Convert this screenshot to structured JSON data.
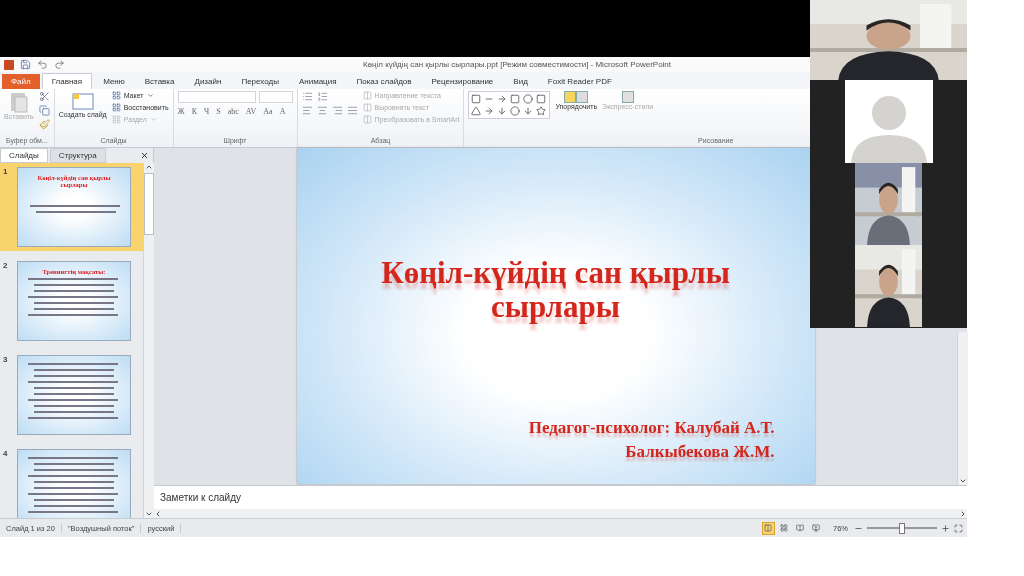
{
  "window": {
    "title": "Көңіл күйдің сан қырлы сырлары.ppt [Режим совместимости] - Microsoft PowerPoint"
  },
  "ribbon": {
    "tabs": [
      {
        "label": "Файл",
        "kind": "file",
        "selected": false
      },
      {
        "label": "Главная",
        "kind": "tab",
        "selected": true
      },
      {
        "label": "Меню",
        "kind": "tab",
        "selected": false
      },
      {
        "label": "Вставка",
        "kind": "tab",
        "selected": false
      },
      {
        "label": "Дизайн",
        "kind": "tab",
        "selected": false
      },
      {
        "label": "Переходы",
        "kind": "tab",
        "selected": false
      },
      {
        "label": "Анимация",
        "kind": "tab",
        "selected": false
      },
      {
        "label": "Показ слайдов",
        "kind": "tab",
        "selected": false
      },
      {
        "label": "Рецензирование",
        "kind": "tab",
        "selected": false
      },
      {
        "label": "Вид",
        "kind": "tab",
        "selected": false
      },
      {
        "label": "Foxit Reader PDF",
        "kind": "tab",
        "selected": false
      }
    ],
    "clipboard": {
      "label": "Буфер обм...",
      "paste": {
        "label": "Вставить",
        "disabled": true
      }
    },
    "slides": {
      "label": "Слайды",
      "new_slide": {
        "label": "Создать слайд",
        "disabled": false
      },
      "commands": [
        {
          "label": "Макет",
          "disabled": false,
          "dropdown": true
        },
        {
          "label": "Восстановить",
          "disabled": false,
          "dropdown": false
        },
        {
          "label": "Раздел",
          "disabled": true,
          "dropdown": true
        }
      ]
    },
    "font": {
      "label": "Шрифт",
      "buttons": [
        "Ж",
        "К",
        "Ч",
        "S",
        "abc",
        "AV",
        "Aa",
        "A"
      ]
    },
    "paragraph": {
      "label": "Абзац",
      "commands": [
        {
          "label": "Направление текста",
          "disabled": true
        },
        {
          "label": "Выровнять текст",
          "disabled": true
        },
        {
          "label": "Преобразовать в SmartArt",
          "disabled": true
        }
      ]
    },
    "drawing": {
      "label": "Рисование",
      "arrange": {
        "label": "Упорядочить",
        "disabled": false
      },
      "quick_styles": {
        "label": "Экспресс-стили",
        "disabled": true
      }
    }
  },
  "slides_pane": {
    "tabs": [
      {
        "label": "Слайды",
        "selected": true
      },
      {
        "label": "Структура",
        "selected": false
      }
    ],
    "thumbnails": [
      {
        "number": "1",
        "selected": true,
        "kind": "title",
        "title": "Көңіл-күйдің сан қырлы сырлары"
      },
      {
        "number": "2",
        "selected": false,
        "kind": "list",
        "title": "Тренингтің мақсаты:"
      },
      {
        "number": "3",
        "selected": false,
        "kind": "bullets"
      },
      {
        "number": "4",
        "selected": false,
        "kind": "bullets"
      }
    ]
  },
  "slide": {
    "title": "Көңіл-күйдің сан қырлы сырлары",
    "authors": [
      "Педагог-психолог: Калубай А.Т.",
      "Балкыбекова Ж.М."
    ]
  },
  "notes": {
    "placeholder": "Заметки к слайду"
  },
  "status_bar": {
    "items": [
      "Слайд 1 из 20",
      "\"Воздушный поток\"",
      "русский"
    ],
    "views": [
      {
        "selected": true
      },
      {
        "selected": false
      },
      {
        "selected": false
      },
      {
        "selected": false
      }
    ],
    "zoom": "76%",
    "level": 0.5
  },
  "video_call": {
    "tiles": [
      {
        "kind": "camera"
      },
      {
        "kind": "avatar"
      },
      {
        "kind": "camera"
      },
      {
        "kind": "camera"
      }
    ]
  }
}
